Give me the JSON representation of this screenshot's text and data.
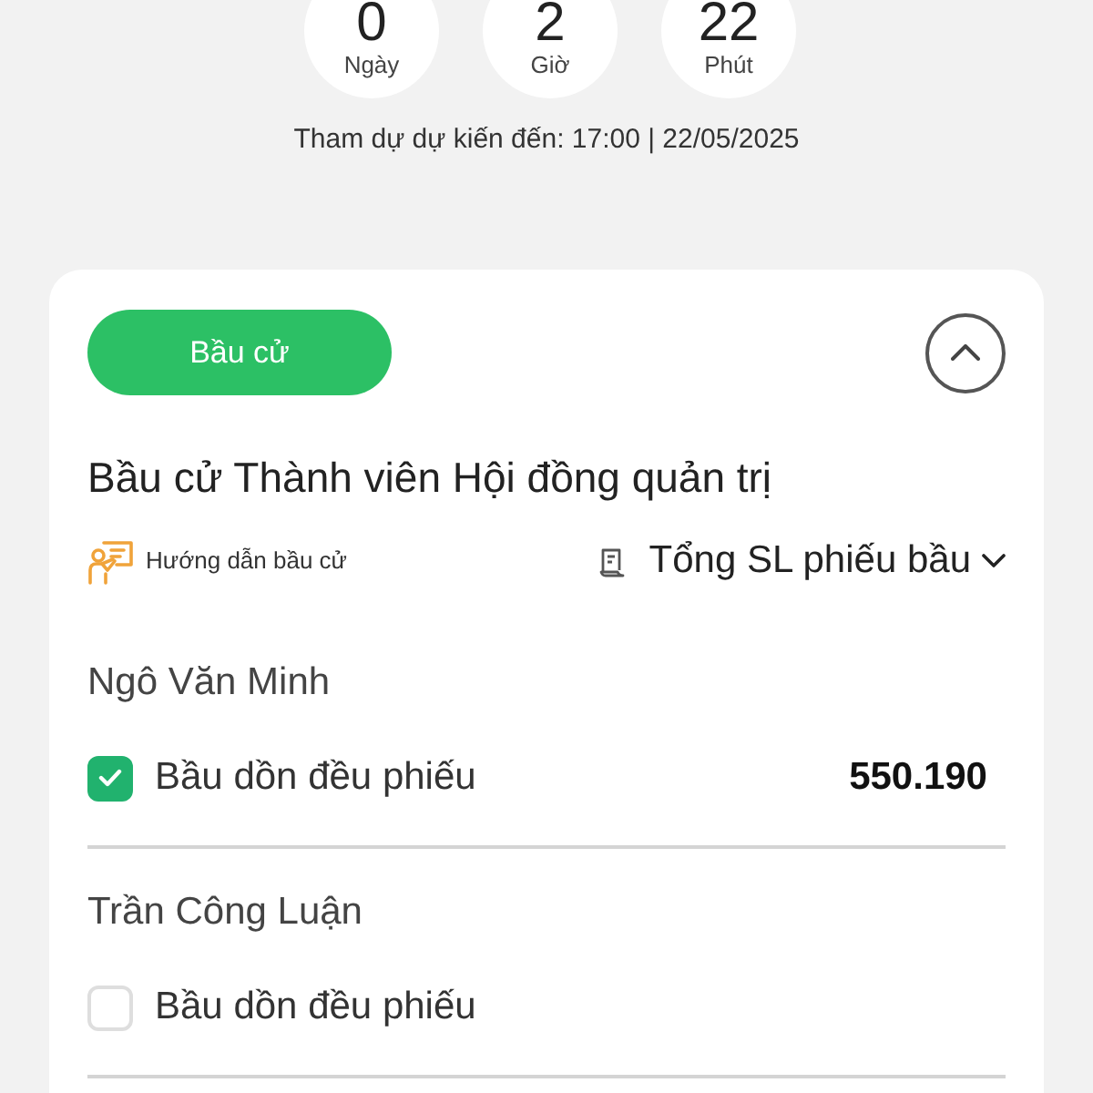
{
  "countdown": [
    {
      "value": "0",
      "unit": "Ngày"
    },
    {
      "value": "2",
      "unit": "Giờ"
    },
    {
      "value": "22",
      "unit": "Phút"
    }
  ],
  "deadline": "Tham dự dự kiến đến: 17:00 | 22/05/2025",
  "card": {
    "tag_button": "Bầu cử",
    "expanded": true,
    "title": "Bầu cử Thành viên Hội đồng quản trị",
    "guide_link": "Hướng dẫn bầu cử",
    "total_votes_dropdown": "Tổng SL phiếu bầu",
    "candidates": [
      {
        "name": "Ngô Văn Minh",
        "option": "Bầu dồn đều phiếu",
        "checked": true,
        "votes": "550.190"
      },
      {
        "name": "Trần Công Luận",
        "option": "Bầu dồn đều phiếu",
        "checked": false
      }
    ]
  }
}
